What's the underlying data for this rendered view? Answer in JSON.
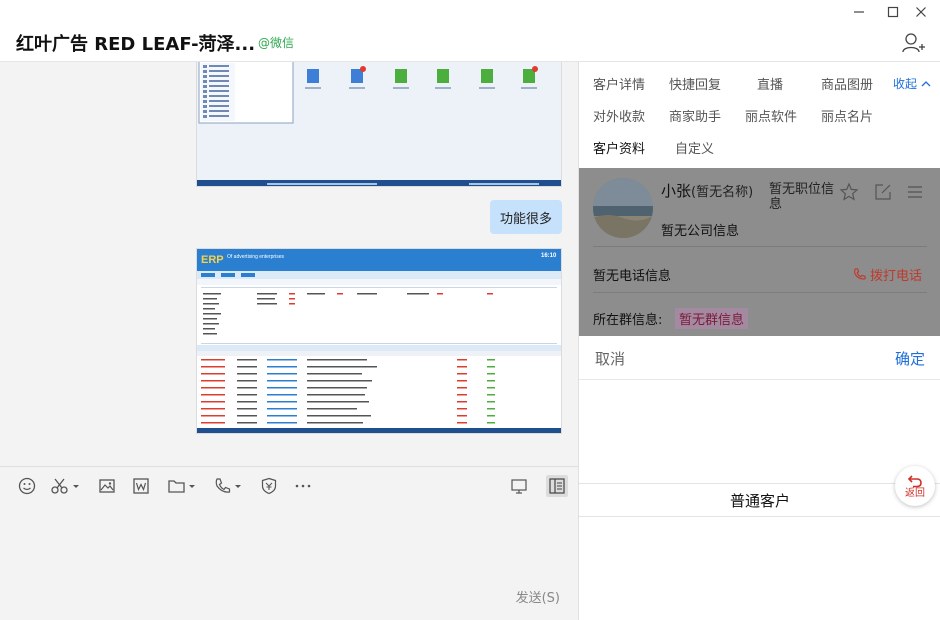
{
  "window": {
    "chat_title": "红叶广告 RED LEAF-菏泽...",
    "source_tag": "@微信"
  },
  "chat": {
    "text_message": "功能很多"
  },
  "erp_screenshot": {
    "logo": "ERP",
    "subtitle": "Of advertising enterprises",
    "time": "16:10"
  },
  "toolbar": {
    "icons": [
      "emoji-icon",
      "scissors-icon",
      "image-icon",
      "word-doc-icon",
      "folder-icon",
      "phone-icon",
      "shield-icon",
      "more-icon",
      "screen-icon",
      "sidebar-toggle-icon"
    ],
    "send_label": "发送(S)"
  },
  "right_panel": {
    "tabs": [
      {
        "label": "客户详情"
      },
      {
        "label": "快捷回复"
      },
      {
        "label": "直播"
      },
      {
        "label": "商品图册"
      },
      {
        "label": "对外收款"
      },
      {
        "label": "商家助手"
      },
      {
        "label": "丽点软件"
      },
      {
        "label": "丽点名片"
      },
      {
        "label": "客户资料"
      },
      {
        "label": "自定义"
      }
    ],
    "collapse_label": "收起",
    "customer": {
      "name": "小张",
      "no_name": "(暂无名称)",
      "no_title": "暂无职位信息",
      "company": "暂无公司信息",
      "phone_info": "暂无电话信息",
      "call_label": "拨打电话",
      "group_label": "所在群信息:",
      "group_value": "暂无群信息"
    },
    "picker": {
      "cancel": "取消",
      "confirm": "确定",
      "option": "普通客户"
    },
    "back_label": "返回"
  },
  "colors": {
    "accent": "#1e6fd9",
    "wechat_green": "#2ea84f",
    "bubble": "#c6e1fb",
    "call_red": "#c0392b"
  }
}
